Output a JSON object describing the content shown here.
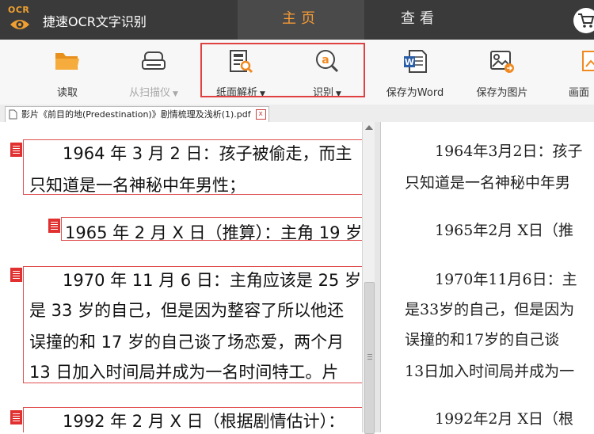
{
  "app": {
    "logo_text": "OCR",
    "title": "捷速OCR文字识别"
  },
  "tabs": [
    {
      "label": "主页",
      "active": true
    },
    {
      "label": "查看",
      "active": false
    }
  ],
  "toolbar": {
    "items": [
      {
        "label": "读取",
        "icon": "folder-icon",
        "enabled": true
      },
      {
        "label": "从扫描仪",
        "icon": "scanner-icon",
        "enabled": false
      },
      {
        "label": "纸面解析",
        "icon": "page-analysis-icon",
        "enabled": true
      },
      {
        "label": "识别",
        "icon": "recognize-icon",
        "enabled": true
      },
      {
        "label": "保存为Word",
        "icon": "word-icon",
        "enabled": true
      },
      {
        "label": "保存为图片",
        "icon": "image-icon",
        "enabled": true
      },
      {
        "label": "画面",
        "icon": "screen-icon",
        "enabled": true
      }
    ],
    "dropdown_arrow": "▼"
  },
  "document_tab": {
    "filename": "影片《前目的地(Predestination)》剧情梳理及浅析(1).pdf",
    "close_label": "x"
  },
  "left_pane": {
    "lines": [
      "　　1964 年 3 月 2 日：孩子被偷走，而主",
      "只知道是一名神秘中年男性；",
      "1965 年 2 月 X 日（推算）：主角 19 岁",
      "　　1970 年 11 月 6 日：主角应该是 25 岁",
      "是 33 岁的自己，但是因为整容了所以他还",
      "误撞的和 17 岁的自己谈了场恋爱，两个月",
      "13 日加入时间局并成为一名时间特工。片",
      "　　1992 年 2 月 X 日（根据剧情估计）："
    ]
  },
  "right_pane": {
    "lines": [
      "　　1964年3月2日：孩子",
      "只知道是一名神秘中年男",
      "　　1965年2月 X日（推",
      "　　1970年11月6日：主",
      "是33岁的自己，但是因为",
      "误撞的和17岁的自己谈",
      "13日加入时间局并成为一",
      "　　1992年2月 X日（根"
    ]
  },
  "colors": {
    "titlebar": "#3a3a3a",
    "active_tab_text": "#f39a36",
    "highlight_border": "#e04040",
    "block_border": "#e05050"
  }
}
